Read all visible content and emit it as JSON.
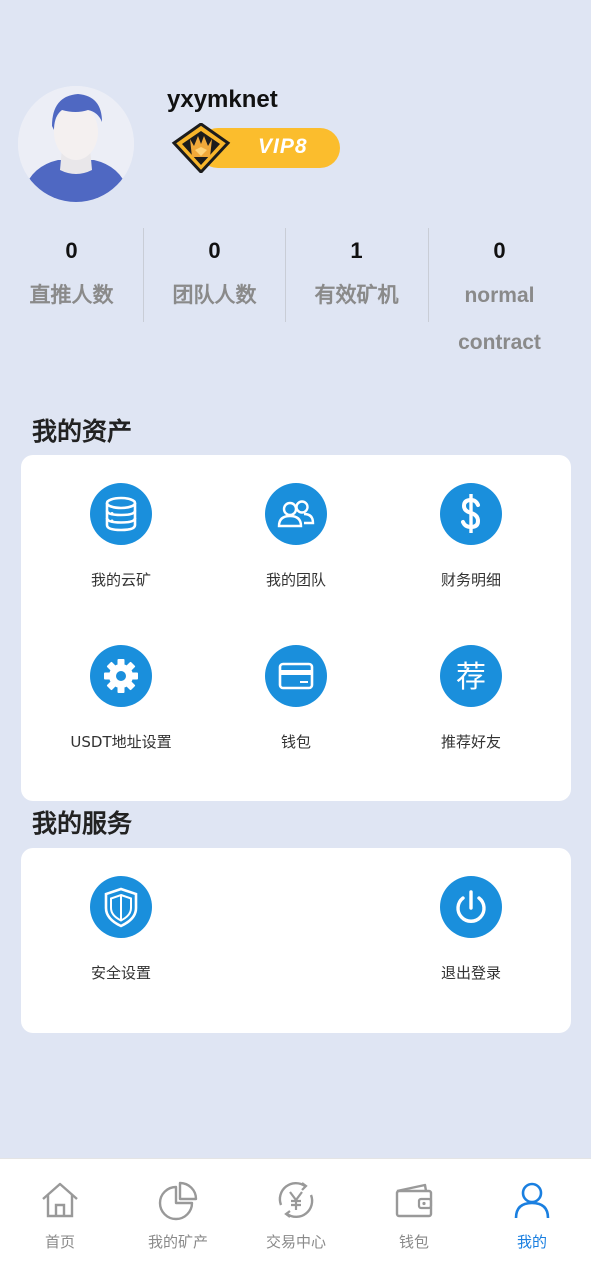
{
  "profile": {
    "username": "yxymknet",
    "vip_label": "VIP8"
  },
  "stats": [
    {
      "value": "0",
      "label": "直推人数"
    },
    {
      "value": "0",
      "label": "团队人数"
    },
    {
      "value": "1",
      "label": "有效矿机"
    },
    {
      "value": "0",
      "label": "normal contract"
    }
  ],
  "assets": {
    "title": "我的资产",
    "items": [
      {
        "label": "我的云矿",
        "icon": "database-icon"
      },
      {
        "label": "我的团队",
        "icon": "team-icon"
      },
      {
        "label": "财务明细",
        "icon": "dollar-icon"
      },
      {
        "label": "USDT地址设置",
        "icon": "gear-icon"
      },
      {
        "label": "钱包",
        "icon": "card-icon"
      },
      {
        "label": "推荐好友",
        "icon": "recommend-icon",
        "glyph": "荐"
      }
    ]
  },
  "services": {
    "title": "我的服务",
    "items": [
      {
        "label": "安全设置",
        "icon": "shield-icon"
      },
      {
        "label": "退出登录",
        "icon": "power-icon"
      }
    ]
  },
  "tabbar": {
    "active": 4,
    "accent": "#1a7fe0",
    "items": [
      {
        "label": "首页",
        "icon": "home-icon"
      },
      {
        "label": "我的矿产",
        "icon": "pie-chart-icon"
      },
      {
        "label": "交易中心",
        "icon": "exchange-yen-icon"
      },
      {
        "label": "钱包",
        "icon": "wallet-icon"
      },
      {
        "label": "我的",
        "icon": "user-icon"
      }
    ]
  },
  "colors": {
    "background": "#dfe5f3",
    "icon_blue": "#1a8fdc",
    "vip_gold": "#fbbd2d"
  }
}
